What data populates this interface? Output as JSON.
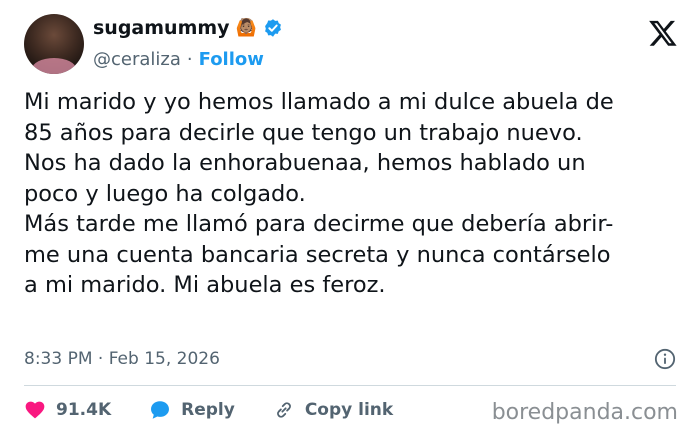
{
  "author": {
    "display_name": "sugamummy",
    "emoji": "🙆🏽",
    "handle": "@ceraliza",
    "separator": "·",
    "follow_label": "Follow",
    "avatar_icon": "avatar-photo"
  },
  "tweet": {
    "lines": [
      "Mi marido y yo hemos llamado a mi dulce abuela de",
      "85 años para decirle que tengo un trabajo nuevo.",
      "Nos ha dado la enhorabuenaa, hemos hablado un",
      "poco y luego ha colgado.",
      "Más tarde me llamó para decirme que debería abrir-",
      "me una cuenta bancaria secreta y nunca contárselo",
      "a mi marido. Mi abuela es feroz."
    ],
    "timestamp": "8:33 PM · Feb 15, 2026"
  },
  "actions": {
    "likes": "91.4K",
    "reply_label": "Reply",
    "copy_link_label": "Copy link"
  },
  "icons": {
    "logo": "x-logo-icon",
    "verified": "verified-badge-icon",
    "info": "info-icon",
    "like": "heart-icon",
    "reply": "reply-bubble-icon",
    "link": "link-icon"
  },
  "colors": {
    "accent": "#1d9bf0",
    "like": "#f91880",
    "muted": "#536471",
    "text": "#0f1419"
  },
  "watermark": "boredpanda.com"
}
